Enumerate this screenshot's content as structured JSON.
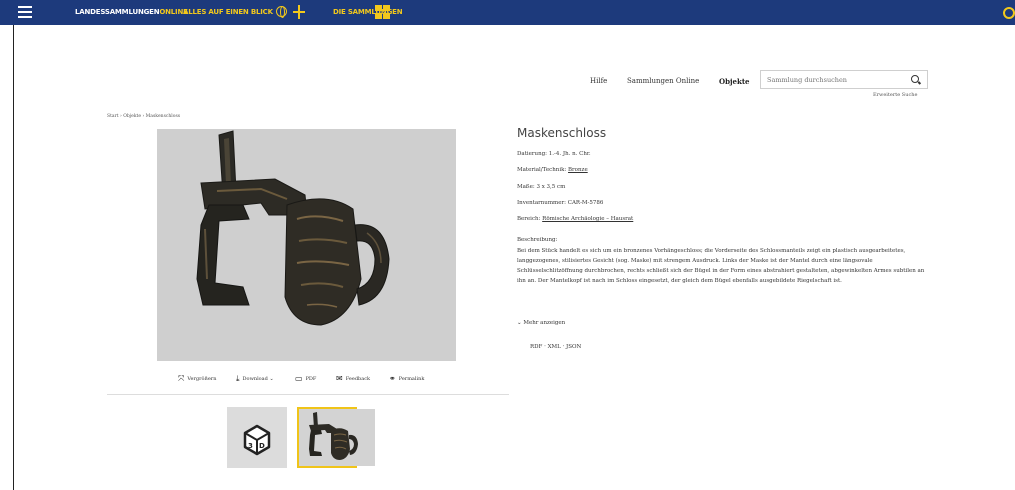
{
  "header": {
    "brand_part1": "LANDESSAMMLUNGEN",
    "brand_part2": "ONLINE",
    "nav_overview": "ALLES AUF EINEN BLICK",
    "nav_collections": "DIE SAMMLUNGEN",
    "bar_color": "#1d3a7c",
    "accent_color": "#f2c81c"
  },
  "subnav": {
    "help": "Hilfe",
    "collections_online": "Sammlungen Online",
    "objects": "Objekte",
    "search_placeholder": "Sammlung durchsuchen",
    "advanced_search": "Erweiterte Suche"
  },
  "breadcrumb": "Start › Objekte › Maskenschloss",
  "toolbar": {
    "zoom": "Vergrößern",
    "download": "Download ⌄",
    "pdf": "PDF",
    "feedback": "Feedback",
    "permalink": "Permalink"
  },
  "object": {
    "title": "Maskenschloss",
    "dating_label": "Datierung:",
    "dating_value": "1.-4. Jh. n. Chr.",
    "material_label": "Material/Technik:",
    "material_value": "Bronze",
    "size_label": "Maße:",
    "size_value": "3 x 3,5 cm",
    "inventory_label": "Inventarnummer:",
    "inventory_value": "CAR-M-5786",
    "area_label": "Bereich:",
    "area_value": "Römische Archäologie – Hausrat",
    "description_label": "Beschreibung:",
    "description": "Bei dem Stück handelt es sich um ein bronzenes Vorhängeschloss; die Vorderseite des Schlossmanteils zeigt ein plastisch ausgearbeitetes, langgezogenes, stilisiertes Gesicht (sog. Maske) mit strengem Ausdruck. Links der Maske ist der Mantel durch eine längsovale Schlüsselschlitzöffnung durchbrochen, rechts schließt sich der Bügel in der Form eines abstrahiert gestalteten, abgewinkelten Armes subtilen an ihn an. Der Mantelkopf ist nach im Schloss eingesetzt, der gleich dem Bügel ebenfalls ausgebildete Riegelschaft ist.",
    "more_label": "Mehr anzeigen",
    "formats": "RDF · XML · JSON"
  }
}
